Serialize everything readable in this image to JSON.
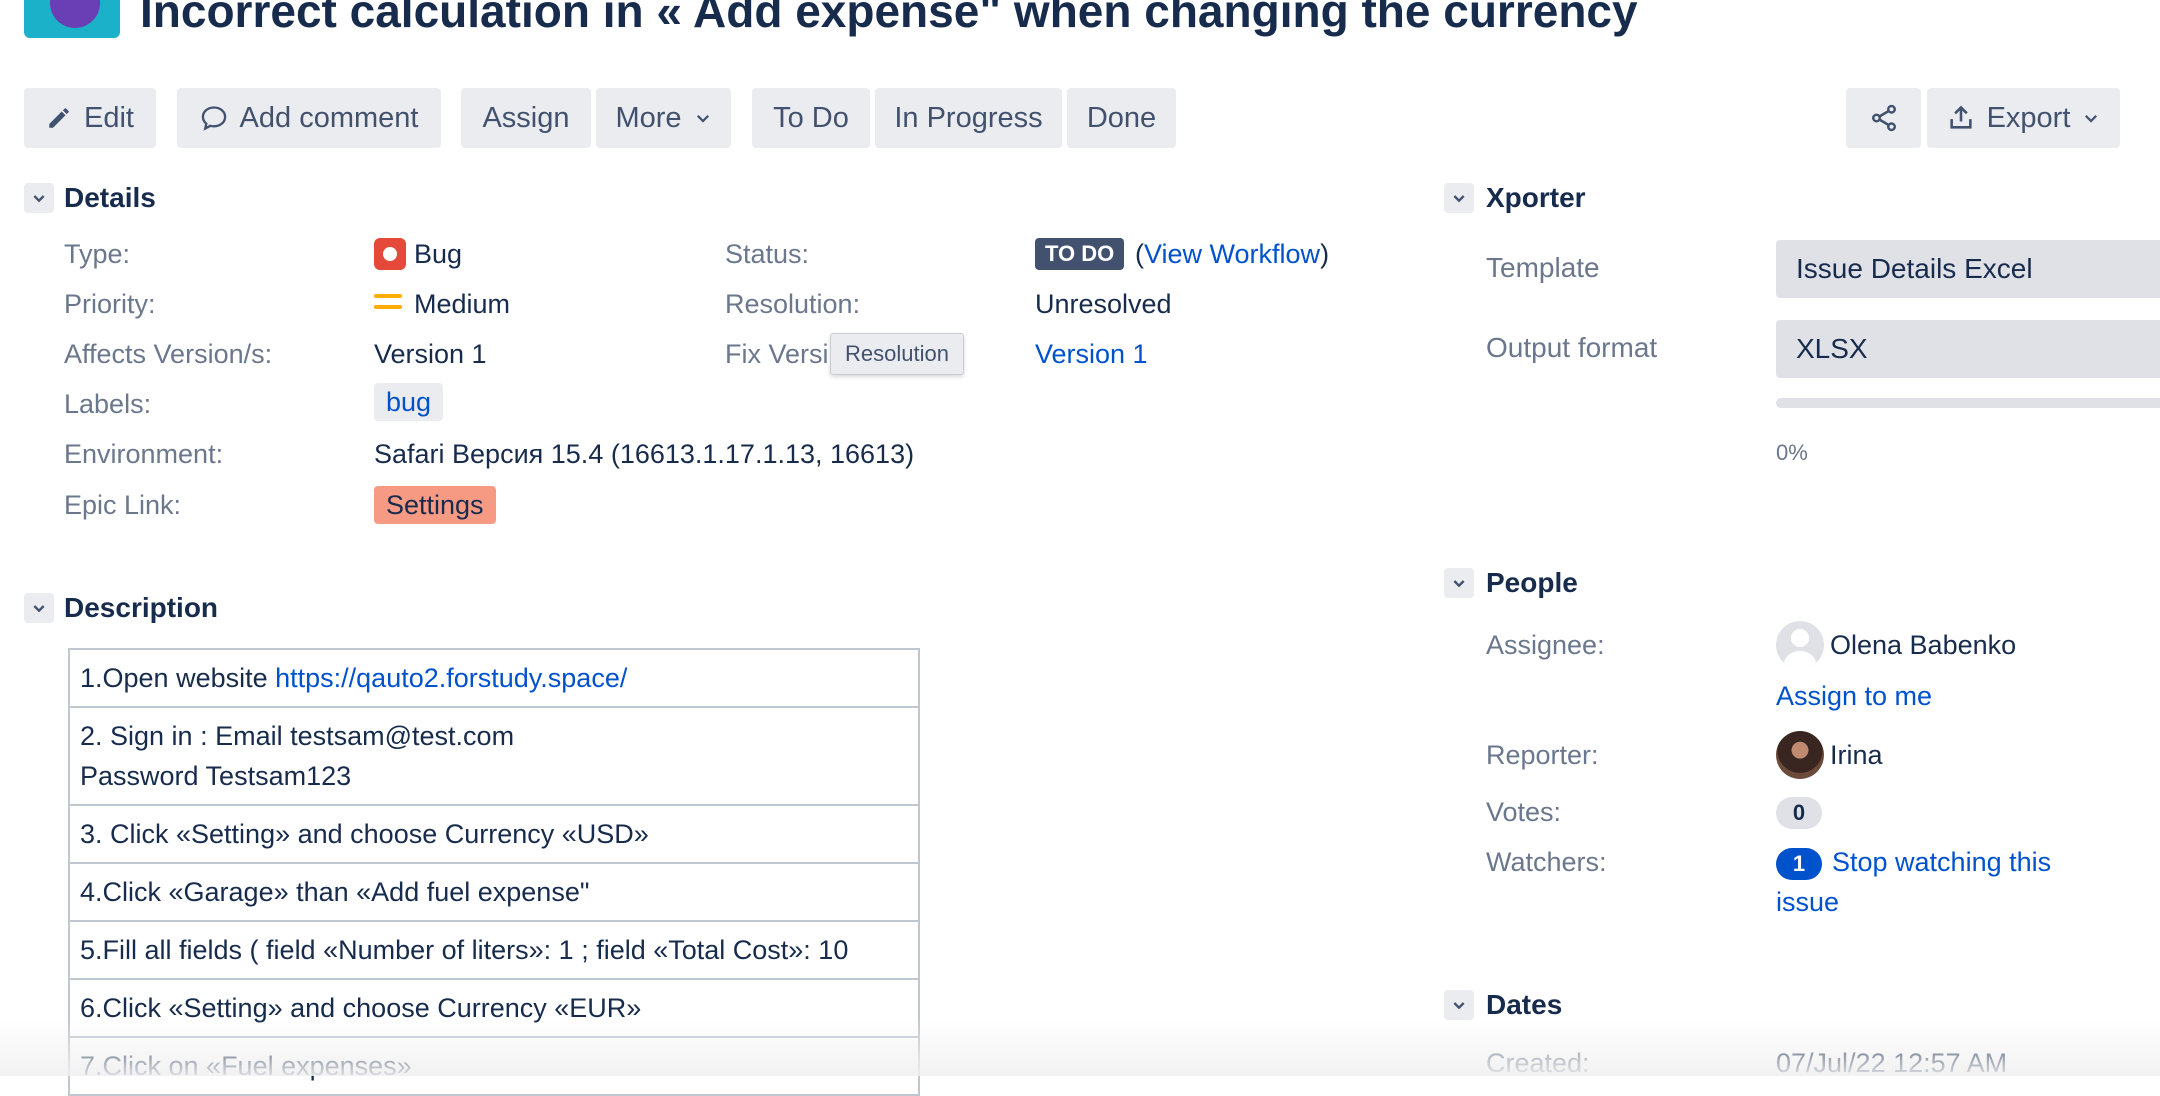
{
  "issue": {
    "title": "Incorrect calculation in « Add expense\" when changing the currency"
  },
  "toolbar": {
    "edit": "Edit",
    "add_comment": "Add comment",
    "assign": "Assign",
    "more": "More",
    "todo": "To Do",
    "in_progress": "In Progress",
    "done": "Done",
    "export": "Export"
  },
  "details": {
    "heading": "Details",
    "type_label": "Type:",
    "type_value": "Bug",
    "priority_label": "Priority:",
    "priority_value": "Medium",
    "affects_label": "Affects Version/s:",
    "affects_value": "Version 1",
    "labels_label": "Labels:",
    "labels_value": "bug",
    "environment_label": "Environment:",
    "environment_value": "Safari Версия 15.4 (16613.1.17.1.13, 16613)",
    "epic_label": "Epic Link:",
    "epic_value": "Settings",
    "status_label": "Status:",
    "status_value": "TO DO",
    "view_workflow": "View Workflow",
    "resolution_label": "Resolution:",
    "resolution_value": "Unresolved",
    "fix_label": "Fix Versi",
    "fix_value": "Version 1",
    "tooltip": "Resolution"
  },
  "description": {
    "heading": "Description",
    "step1_text": "1.Open website ",
    "step1_link": "https://qauto2.forstudy.space/",
    "step2_line1": "2. Sign in : Email testsam@test.com",
    "step2_line2": "Password Testsam123",
    "step3": "3. Click «Setting» and choose Currency «USD»",
    "step4": "4.Click «Garage» than «Add fuel expense\"",
    "step5": "5.Fill all fields ( field «Number of liters»: 1 ; field «Total Cost»: 10",
    "step6": "6.Click «Setting» and choose Currency «EUR»",
    "step7": "7.Click on «Fuel expenses»"
  },
  "xporter": {
    "heading": "Xporter",
    "template_label": "Template",
    "template_value": "Issue Details Excel",
    "format_label": "Output format",
    "format_value": "XLSX",
    "progress_text": "0%",
    "progress": 0
  },
  "people": {
    "heading": "People",
    "assignee_label": "Assignee:",
    "assignee_name": "Olena Babenko",
    "assign_to_me": "Assign to me",
    "reporter_label": "Reporter:",
    "reporter_name": "Irina",
    "votes_label": "Votes:",
    "votes_count": "0",
    "watchers_label": "Watchers:",
    "watchers_count": "1",
    "stop_watching_line1": "Stop watching this",
    "stop_watching_line2": "issue"
  },
  "dates": {
    "heading": "Dates",
    "created_label": "Created:",
    "created_value": "07/Jul/22 12:57 AM"
  },
  "colors": {
    "link": "#0052cc",
    "text": "#172b4d",
    "label": "#6b778c",
    "button_bg": "#ebecf0",
    "bug": "#e5493a",
    "priority_medium": "#ffab00",
    "epic": "#f79a84"
  }
}
